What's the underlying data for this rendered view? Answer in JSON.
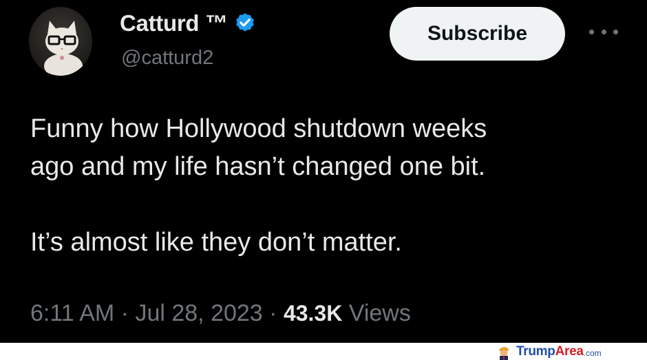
{
  "author": {
    "display_name": "Catturd ™",
    "handle": "@catturd2",
    "verified_icon": "verified-badge-icon",
    "avatar_icon": "cat-with-glasses"
  },
  "subscribe_label": "Subscribe",
  "more_icon": "more-horizontal-icon",
  "tweet": {
    "line1": "Funny how Hollywood shutdown weeks",
    "line2": "ago and my life hasn’t changed one bit.",
    "line3": "It’s almost like they don’t matter."
  },
  "meta": {
    "time": "6:11 AM",
    "separator": " · ",
    "date": "Jul 28, 2023",
    "views_count": "43.3K",
    "views_label": " Views"
  },
  "watermark": {
    "part1": "Trump",
    "part2": "Area",
    "suffix": ".com"
  },
  "colors": {
    "background": "#000000",
    "text": "#e7e9ea",
    "muted": "#71767b",
    "verified": "#1d9bf0",
    "button_bg": "#eff3f4"
  }
}
